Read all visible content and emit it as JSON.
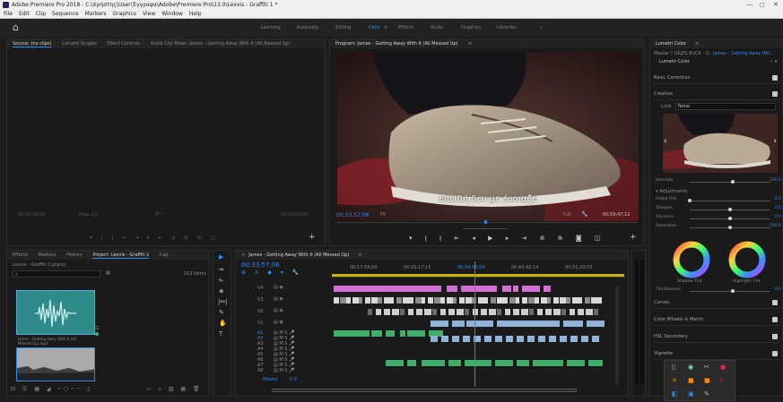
{
  "window": {
    "title": "Adobe Premiere Pro 2018 - C:\\Χρήστης\\User\\Έγγραφα\\Adobe\\Premiere Pro\\13.0\\Lexxis - Graffiti 1 *",
    "minimize": "—",
    "maximize": "◻",
    "close": "✕"
  },
  "menu": [
    "File",
    "Edit",
    "Clip",
    "Sequence",
    "Markers",
    "Graphics",
    "View",
    "Window",
    "Help"
  ],
  "workspaces": [
    "Learning",
    "Assembly",
    "Editing",
    "Color",
    "Effects",
    "Audio",
    "Graphics",
    "Libraries"
  ],
  "active_workspace": "Color",
  "source_panel": {
    "tabs": [
      "Source: (no clips)",
      "Lumetri Scopes",
      "Effect Controls",
      "Audio Clip Mixer: James - Getting Away With It (All Messed Up)"
    ],
    "timecode_left": "00;00;00;00",
    "timecode_right": "00;00;00;00",
    "fit": "Page 1/1"
  },
  "program_panel": {
    "tab": "Program: James - Getting Away With It (All Messed Up)",
    "subtitle": "επειδή δεν με ένοιαζε",
    "timecode": "00;33;57;06",
    "fit": "Fit",
    "quality": "Full",
    "duration": "00;59;47;12"
  },
  "project_panel": {
    "tabs": [
      "Effects",
      "Markers",
      "History",
      "Project: Lexxis - Graffiti 1",
      "Cap"
    ],
    "path": "Lexxis - Graffiti 1.prproj",
    "item_count": "162 Items",
    "clip1_name": "James - Getting Away With It (All Messed Up).mp3",
    "search_placeholder": ""
  },
  "timeline": {
    "tab": "James - Getting Away With It (All Messed Up)",
    "timecode": "00;33;57;06",
    "ruler": [
      "00;17;59;00",
      "00;25;17;16",
      "00;34;59;00",
      "00;42;42;14",
      "00;51;23;02"
    ],
    "video_tracks": [
      "V4",
      "V3",
      "V2",
      "V1"
    ],
    "audio_tracks": [
      "A1",
      "A2",
      "A3",
      "A4",
      "A5",
      "A6",
      "A7",
      "A8"
    ],
    "master": "Master",
    "master_value": "0.0"
  },
  "lumetri": {
    "tab": "Lumetri Color",
    "source": "Master * GILES BUCK - Cine...",
    "sequence": "James - Getting Away Wit...",
    "effect": "Lumetri Color",
    "sections": {
      "basic": "Basic Correction",
      "creative": "Creative",
      "curves": "Curves",
      "wheels": "Color Wheels & Match",
      "hsl": "HSL Secondary",
      "vignette": "Vignette"
    },
    "look_label": "Look",
    "look_value": "None",
    "intensity_label": "Intensity",
    "intensity_value": "100.0",
    "adjustments_label": "Adjustments",
    "sliders": [
      {
        "label": "Faded Film",
        "value": "0.0",
        "pos": 0.0
      },
      {
        "label": "Sharpen",
        "value": "0.0",
        "pos": 0.5
      },
      {
        "label": "Vibrance",
        "value": "0.0",
        "pos": 0.5
      },
      {
        "label": "Saturation",
        "value": "100.0",
        "pos": 0.5
      }
    ],
    "shadow_tint": "Shadow Tint",
    "highlight_tint": "Highlight Tint",
    "tint_balance_label": "Tint Balance",
    "tint_balance_value": "0.0"
  },
  "colors": {
    "accent": "#2d8ceb",
    "pink_clip": "#d36fd3",
    "blue_clip": "#8fb3d9",
    "green_clip": "#3fae6a"
  }
}
